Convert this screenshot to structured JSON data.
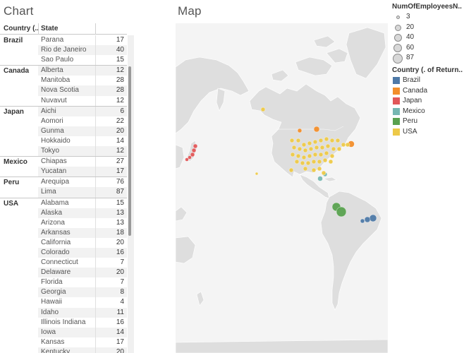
{
  "panels": {
    "chart_title": "Chart",
    "map_title": "Map"
  },
  "table": {
    "col_country": "Country (..",
    "col_state": "State",
    "groups": [
      {
        "country": "Brazil",
        "rows": [
          {
            "state": "Parana",
            "value": "17"
          },
          {
            "state": "Rio de Janeiro",
            "value": "40"
          },
          {
            "state": "Sao Paulo",
            "value": "15"
          }
        ]
      },
      {
        "country": "Canada",
        "rows": [
          {
            "state": "Alberta",
            "value": "12"
          },
          {
            "state": "Manitoba",
            "value": "28"
          },
          {
            "state": "Nova Scotia",
            "value": "28"
          },
          {
            "state": "Nuvavut",
            "value": "12"
          }
        ]
      },
      {
        "country": "Japan",
        "rows": [
          {
            "state": "Aichi",
            "value": "6"
          },
          {
            "state": "Aomori",
            "value": "22"
          },
          {
            "state": "Gunma",
            "value": "20"
          },
          {
            "state": "Hokkaido",
            "value": "14"
          },
          {
            "state": "Tokyo",
            "value": "12"
          }
        ]
      },
      {
        "country": "Mexico",
        "rows": [
          {
            "state": "Chiapas",
            "value": "27"
          },
          {
            "state": "Yucatan",
            "value": "17"
          }
        ]
      },
      {
        "country": "Peru",
        "rows": [
          {
            "state": "Arequipa",
            "value": "76"
          },
          {
            "state": "Lima",
            "value": "87"
          }
        ]
      },
      {
        "country": "USA",
        "rows": [
          {
            "state": "Alabama",
            "value": "15"
          },
          {
            "state": "Alaska",
            "value": "13"
          },
          {
            "state": "Arizona",
            "value": "13"
          },
          {
            "state": "Arkansas",
            "value": "18"
          },
          {
            "state": "California",
            "value": "20"
          },
          {
            "state": "Colorado",
            "value": "16"
          },
          {
            "state": "Connecticut",
            "value": "7"
          },
          {
            "state": "Delaware",
            "value": "20"
          },
          {
            "state": "Florida",
            "value": "7"
          },
          {
            "state": "Georgia",
            "value": "8"
          },
          {
            "state": "Hawaii",
            "value": "4"
          },
          {
            "state": "Idaho",
            "value": "11"
          },
          {
            "state": "Illinois Indiana",
            "value": "16"
          },
          {
            "state": "Iowa",
            "value": "14"
          },
          {
            "state": "Kansas",
            "value": "17"
          },
          {
            "state": "Kentucky",
            "value": "20"
          }
        ]
      }
    ]
  },
  "size_legend": {
    "title": "NumOfEmployeesN..",
    "items": [
      "3",
      "20",
      "40",
      "60",
      "87"
    ]
  },
  "color_legend": {
    "title": "Country (. of Return..",
    "items": [
      {
        "label": "Brazil",
        "color": "#4e79a7"
      },
      {
        "label": "Canada",
        "color": "#f28e2b"
      },
      {
        "label": "Japan",
        "color": "#e15759"
      },
      {
        "label": "Mexico",
        "color": "#76b7b2"
      },
      {
        "label": "Peru",
        "color": "#59a14f"
      },
      {
        "label": "USA",
        "color": "#edc948"
      }
    ]
  }
}
